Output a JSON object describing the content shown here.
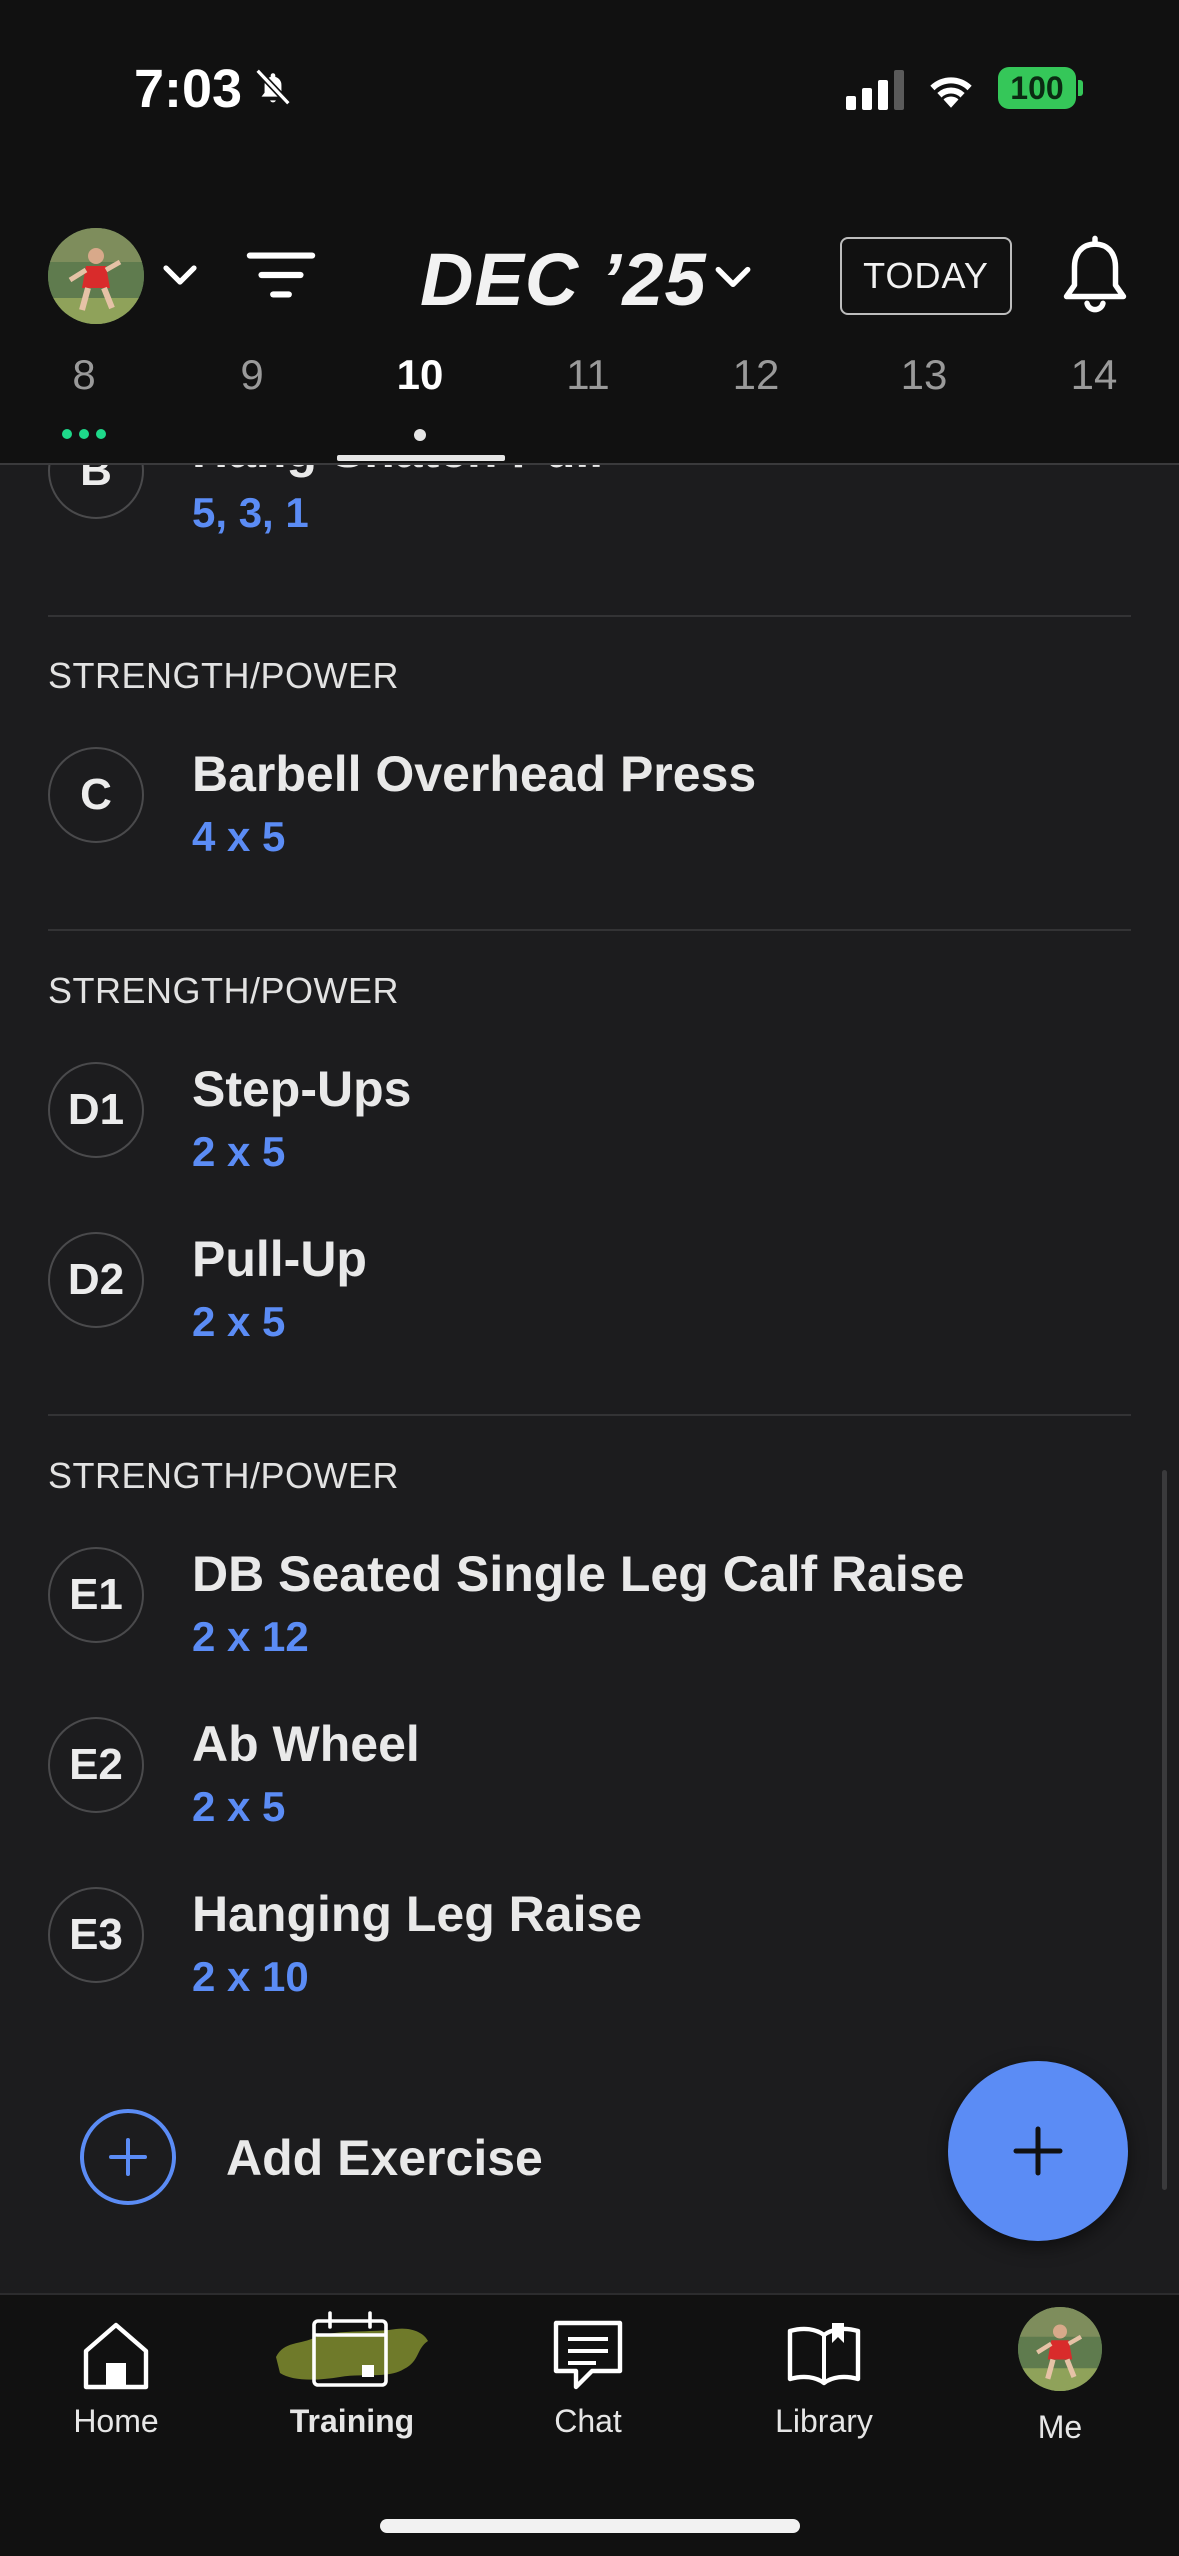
{
  "status_bar": {
    "time": "7:03",
    "battery": "100"
  },
  "header": {
    "month": "DEC ’25",
    "today_label": "TODAY",
    "days": [
      {
        "num": "8",
        "dots": "green"
      },
      {
        "num": "9",
        "dots": ""
      },
      {
        "num": "10",
        "dots": "white",
        "active": true
      },
      {
        "num": "11",
        "dots": ""
      },
      {
        "num": "12",
        "dots": ""
      },
      {
        "num": "13",
        "dots": ""
      },
      {
        "num": "14",
        "dots": ""
      }
    ]
  },
  "workout": {
    "partial_item": {
      "badge": "B",
      "name": "Hang Snatch Pull",
      "sets": "5, 3, 1"
    },
    "sections": [
      {
        "label": "STRENGTH/POWER",
        "items": [
          {
            "badge": "C",
            "name": "Barbell Overhead Press",
            "sets": "4 x 5"
          }
        ]
      },
      {
        "label": "STRENGTH/POWER",
        "items": [
          {
            "badge": "D1",
            "name": "Step-Ups",
            "sets": "2 x 5"
          },
          {
            "badge": "D2",
            "name": "Pull-Up",
            "sets": "2 x 5"
          }
        ]
      },
      {
        "label": "STRENGTH/POWER",
        "items": [
          {
            "badge": "E1",
            "name": "DB Seated Single Leg Calf Raise",
            "sets": "2 x 12"
          },
          {
            "badge": "E2",
            "name": "Ab Wheel",
            "sets": "2 x 5"
          },
          {
            "badge": "E3",
            "name": "Hanging Leg Raise",
            "sets": "2 x 10"
          }
        ]
      }
    ],
    "add_exercise_label": "Add Exercise"
  },
  "tab_bar": {
    "tabs": [
      {
        "label": "Home",
        "icon": "home-icon"
      },
      {
        "label": "Training",
        "icon": "calendar-icon",
        "active": true
      },
      {
        "label": "Chat",
        "icon": "chat-icon"
      },
      {
        "label": "Library",
        "icon": "book-icon"
      },
      {
        "label": "Me",
        "icon": "avatar"
      }
    ]
  },
  "colors": {
    "accent": "#5b8cf5",
    "success": "#1ed98a",
    "background": "#1c1c1e",
    "header": "#111111"
  }
}
